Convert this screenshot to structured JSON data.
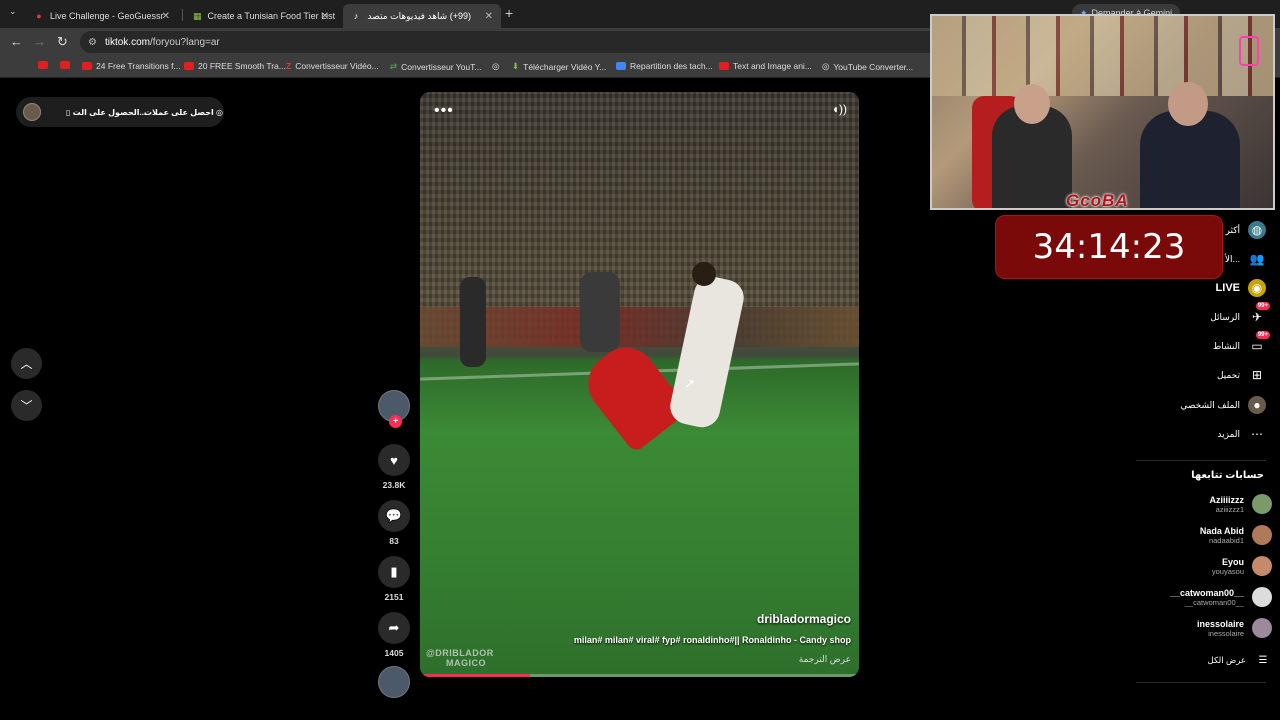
{
  "browser": {
    "tabs": [
      {
        "title": "Live Challenge - GeoGuessr",
        "icon": "map-pin-icon"
      },
      {
        "title": "Create a Tunisian Food Tier List",
        "icon": "tier-list-icon"
      },
      {
        "title": "(99+) شاهد فيديوهات متصدرة",
        "icon": "tiktok-icon"
      }
    ],
    "url": "tiktok.com/foryou?lang=ar",
    "url_host": "tiktok.com",
    "url_path": "/foryou?lang=ar",
    "gemini_label": "Demander à Gemini",
    "bookmarks": [
      {
        "label": "",
        "icon": "youtube-icon"
      },
      {
        "label": "",
        "icon": "youtube-icon"
      },
      {
        "label": "24 Free Transitions f...",
        "icon": "youtube-icon"
      },
      {
        "label": "20 FREE Smooth Tra...",
        "icon": "youtube-icon"
      },
      {
        "label": "Convertisseur Vidéo...",
        "icon": "z-icon"
      },
      {
        "label": "Convertisseur YouT...",
        "icon": "convert-icon"
      },
      {
        "label": "",
        "icon": "globe-icon"
      },
      {
        "label": "Télécharger Vidéo Y...",
        "icon": "download-icon"
      },
      {
        "label": "Repartition des tach...",
        "icon": "docs-icon"
      },
      {
        "label": "Text and Image ani...",
        "icon": "youtube-icon"
      },
      {
        "label": "YouTube Converter...",
        "icon": "globe-icon"
      }
    ]
  },
  "topbar": {
    "coins_label": "احصل على عملات",
    "app_label": "الحصول على الت..."
  },
  "video": {
    "author": "dribladormagico",
    "caption": "milan# milan# viral# fyp# ronaldinho#|| Ronaldinho - Candy shop",
    "translate_label": "عرض الترجمة",
    "watermark_line1": "@DRIBLADOR",
    "watermark_line2": "MAGICO",
    "progress": 0.25
  },
  "actions": {
    "likes": "23.8K",
    "comments": "83",
    "saves": "2151",
    "shares": "1405"
  },
  "sidebar": {
    "nav": [
      {
        "label": "أكثر",
        "icon": "explore-icon"
      },
      {
        "label": "الأ...",
        "icon": "following-icon"
      },
      {
        "label": "LIVE",
        "icon": "live-icon"
      },
      {
        "label": "الرسائل",
        "icon": "messages-icon",
        "badge": "99+"
      },
      {
        "label": "النشاط",
        "icon": "activity-icon",
        "badge": "99+"
      },
      {
        "label": "تحميل",
        "icon": "upload-icon"
      },
      {
        "label": "الملف الشخصي",
        "icon": "profile-icon"
      },
      {
        "label": "المزيد",
        "icon": "more-icon"
      }
    ],
    "following_title": "حسابات تتابعها",
    "following": [
      {
        "name": "Aziiiizzz",
        "handle": "aziiizzz1"
      },
      {
        "name": "Nada Abid",
        "handle": "nadaabid1"
      },
      {
        "name": "Eyou",
        "handle": "youyasou"
      },
      {
        "name": "__catwoman00__",
        "handle": "__catwoman00__"
      },
      {
        "name": "inessolaire",
        "handle": "inessolaire"
      }
    ],
    "see_all": "عرض الكل"
  },
  "overlay": {
    "logo_text": "GcoBA",
    "timer": "34:14:23"
  },
  "colors": {
    "accent": "#fe2c55",
    "timer_bg": "#7a0a0a"
  }
}
